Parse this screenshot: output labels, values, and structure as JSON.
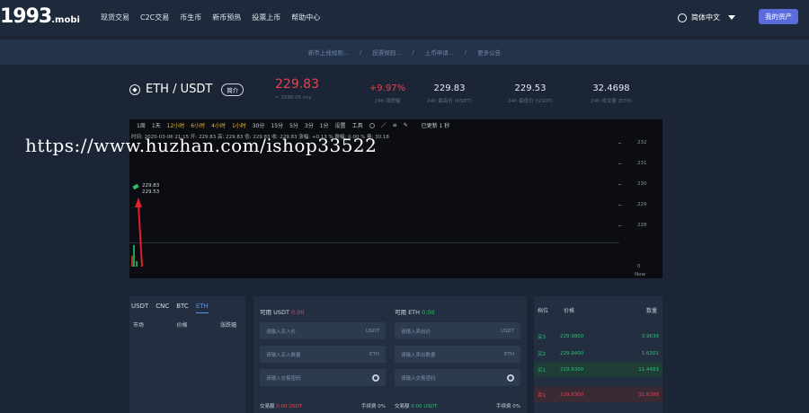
{
  "brand": {
    "logo_main": "1993",
    "logo_suffix": ".mobi"
  },
  "nav": {
    "items": [
      "现货交易",
      "C2C交易",
      "币生币",
      "新币预热",
      "投票上币",
      "帮助中心"
    ]
  },
  "header": {
    "language": "简体中文",
    "assets_button": "我的资产"
  },
  "announcements": {
    "items": [
      "新币上线规则...",
      "投票规则...",
      "上币申请...",
      "更多公告"
    ],
    "separator": "/"
  },
  "ticker": {
    "pair": "ETH / USDT",
    "intro_label": "简介",
    "last_price": "229.83",
    "cny_price": "≈ 1590.05 cny",
    "change": "+9.97%",
    "change_label": "24h 涨跌幅",
    "high": "229.83",
    "high_label": "24h 最高价 (USDT)",
    "low": "229.53",
    "low_label": "24h 最低价 (USDT)",
    "volume": "32.4698",
    "volume_label": "24h 成交量 (ETH)"
  },
  "chart": {
    "toolbar": [
      "1周",
      "1天",
      "12小时",
      "6小时",
      "4小时",
      "1小时",
      "30分",
      "15分",
      "5分",
      "3分",
      "1分"
    ],
    "toolbar_active": "1小时",
    "settings": "设置",
    "tools": "工具",
    "update_label": "已更新 1 秒",
    "ohlc_line": "时间: 2020-03-06 21:15   开: 229.83   高: 229.83   低: 229.83   收: 229.83   涨幅: +0.13 %   振幅: 0.00 %   量: 30.18",
    "price_labels": [
      "229.83",
      "229.53"
    ],
    "now_label": "Now"
  },
  "chart_data": {
    "type": "line",
    "yticks": [
      232,
      231,
      230,
      229,
      228
    ],
    "volume_ticks": [
      0
    ],
    "last": 229.83,
    "low": 229.53
  },
  "watermark": "https://www.huzhan.com/ishop33522",
  "market": {
    "tabs": [
      "USDT",
      "CNC",
      "BTC",
      "ETH"
    ],
    "active_tab": "ETH",
    "headers": [
      "市场",
      "价格",
      "涨跌幅"
    ]
  },
  "trade": {
    "buy": {
      "avail_label": "可用 USDT",
      "avail_value": "0.00",
      "price_placeholder": "请输入买入价",
      "price_unit": "USDT",
      "qty_placeholder": "请输入买入数量",
      "qty_unit": "ETH",
      "pwd_placeholder": "请输入交易密码",
      "total_label": "交易额",
      "total_value": "0.00 USDT",
      "fee_label": "手续费 0%"
    },
    "sell": {
      "avail_label": "可用 ETH",
      "avail_value": "0.00",
      "price_placeholder": "请输入卖出价",
      "price_unit": "USDT",
      "qty_placeholder": "请输入卖出数量",
      "qty_unit": "ETH",
      "pwd_placeholder": "请输入交易密码",
      "total_label": "交易额",
      "total_value": "0.00 USDT",
      "fee_label": "手续费 0%"
    }
  },
  "orderbook": {
    "headers": [
      "档位",
      "价格",
      "数量"
    ],
    "rows": [
      {
        "level": "买3",
        "price": "229.9800",
        "amount": "3.9639",
        "side": "buy"
      },
      {
        "level": "买2",
        "price": "229.9400",
        "amount": "1.6201",
        "side": "buy"
      },
      {
        "level": "买1",
        "price": "229.8300",
        "amount": "11.4483",
        "side": "buy"
      },
      {
        "level": "卖1",
        "price": "229.8300",
        "amount": "31.9398",
        "side": "sell"
      }
    ]
  },
  "colors": {
    "up": "#2fbf71",
    "down": "#e8434f",
    "accent": "#5b6bdc",
    "chart_active": "#e8b53a"
  }
}
